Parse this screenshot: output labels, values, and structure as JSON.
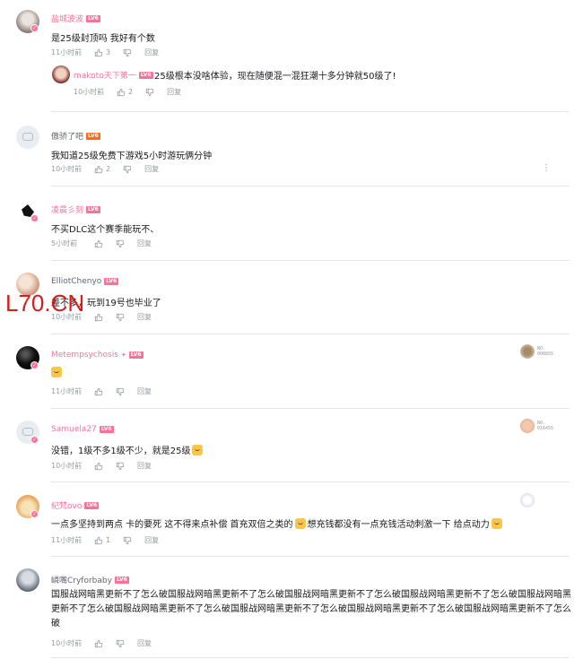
{
  "watermark": "L70.CN",
  "comments": [
    {
      "username": "盐城波波",
      "level": "LV6",
      "text": "是25级封顶吗 我好有个数",
      "time": "11小时前",
      "likes": "3",
      "reply_label": "回复",
      "reply": {
        "username": "makoto天下第一",
        "level": "LV6",
        "text": "25级根本没啥体验，现在随便混一混狂潮十多分钟就50级了!",
        "time": "10小时前",
        "likes": "2",
        "reply_label": "回复"
      }
    },
    {
      "username": "傲骄了吧",
      "level": "LV6",
      "text": "我知道25级免费下游戏5小时游玩俩分钟",
      "time": "10小时前",
      "likes": "2",
      "reply_label": "回复",
      "more": "⋮"
    },
    {
      "username": "凌晨彡刻",
      "level": "LV6",
      "text": "不买DLC这个赛季能玩不、",
      "time": "5小时前",
      "likes": "",
      "reply_label": "回复"
    },
    {
      "username": "ElliotChenyo",
      "level": "LV6",
      "text": "差不多，玩到19号也毕业了",
      "time": "10小时前",
      "likes": "",
      "reply_label": "回复"
    },
    {
      "username": "Metempsychosis",
      "level": "LV6",
      "text": "",
      "time": "11小时前",
      "likes": "",
      "reply_label": "回复",
      "medal_no": "NO.\n008855"
    },
    {
      "username": "Samuela27",
      "level": "LV6",
      "text": "没错，1级不多1级不少，就是25级",
      "time": "10小时前",
      "likes": "",
      "reply_label": "回复",
      "medal_no": "NO.\n016455"
    },
    {
      "username": "纪梵ovo",
      "level": "LV6",
      "text_a": "一点多坚持到两点 卡的要死 这不得来点补偿 首充双倍之类的",
      "text_b": "想充钱都没有一点充钱活动刺激一下 给点动力",
      "time": "11小时前",
      "likes": "1",
      "reply_label": "回复"
    },
    {
      "username": "嶙嘴Cryforbaby",
      "level": "LV6",
      "text": "国服战网暗黑更新不了怎么破国服战网暗黑更新不了怎么破国服战网暗黑更新不了怎么破国服战网暗黑更新不了怎么破国服战网暗黑更新不了怎么破国服战网暗黑更新不了怎么破国服战网暗黑更新不了怎么破国服战网暗黑更新不了怎么破国服战网暗黑更新不了怎么破",
      "time": "10小时前",
      "likes": "",
      "reply_label": "回复"
    }
  ],
  "colors": {
    "vip_name": "#fb7299",
    "level_badge": "#fb7299",
    "meta": "#9499a0",
    "divider": "#e3e5e7"
  }
}
